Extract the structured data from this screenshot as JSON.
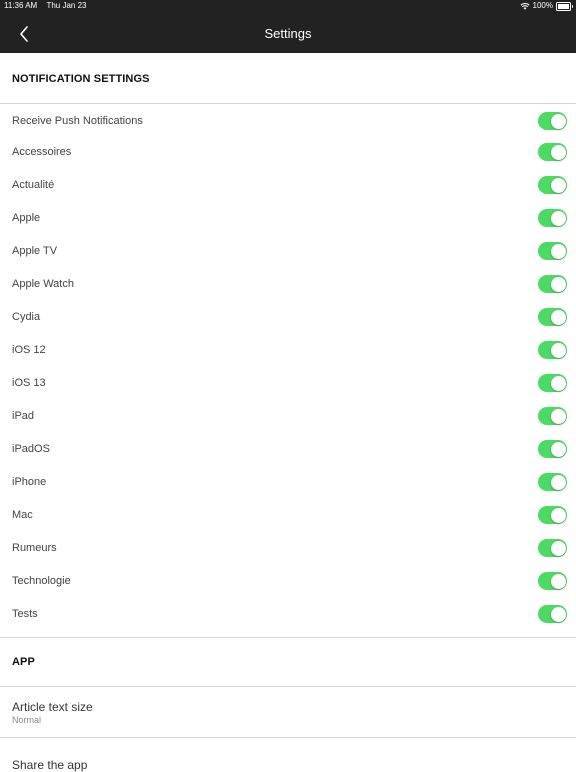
{
  "status_bar": {
    "time": "11:36 AM",
    "date": "Thu Jan 23",
    "battery_percent": "100%"
  },
  "nav": {
    "title": "Settings",
    "back_icon": "chevron-left-icon"
  },
  "notifications": {
    "section_title": "NOTIFICATION SETTINGS",
    "items": [
      {
        "label": "Receive Push Notifications",
        "enabled": true
      },
      {
        "label": "Accessoires",
        "enabled": true
      },
      {
        "label": "Actualité",
        "enabled": true
      },
      {
        "label": "Apple",
        "enabled": true
      },
      {
        "label": "Apple TV",
        "enabled": true
      },
      {
        "label": "Apple Watch",
        "enabled": true
      },
      {
        "label": "Cydia",
        "enabled": true
      },
      {
        "label": "iOS 12",
        "enabled": true
      },
      {
        "label": "iOS 13",
        "enabled": true
      },
      {
        "label": "iPad",
        "enabled": true
      },
      {
        "label": "iPadOS",
        "enabled": true
      },
      {
        "label": "iPhone",
        "enabled": true
      },
      {
        "label": "Mac",
        "enabled": true
      },
      {
        "label": "Rumeurs",
        "enabled": true
      },
      {
        "label": "Technologie",
        "enabled": true
      },
      {
        "label": "Tests",
        "enabled": true
      }
    ]
  },
  "app_section": {
    "title": "APP",
    "article_text_size": {
      "label": "Article text size",
      "value": "Normal"
    },
    "share": {
      "label": "Share the app"
    }
  },
  "colors": {
    "header_bg": "#222222",
    "toggle_on": "#4cd964",
    "divider": "#d6d6d6"
  }
}
